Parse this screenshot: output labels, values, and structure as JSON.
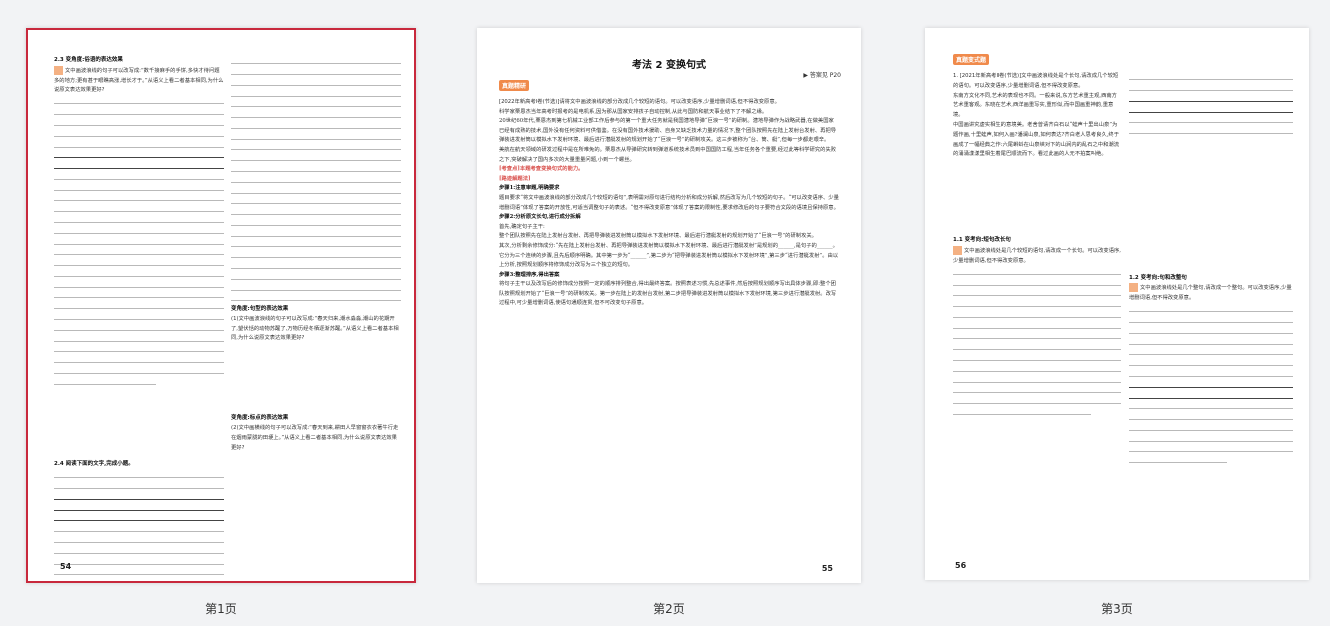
{
  "pages": [
    {
      "label": "第1页",
      "page_number": "54",
      "selected": true,
      "left_col": {
        "sec1_title": "2.3 变角度:俗语的表达效果",
        "sec1_q": "文中画波浪线的句子可以改写成:“数千接麻手的手饼,多快才待问题多的地方;更有甚于眼瞧高涨,增长才于。”从语义上看二者基本相同,为什么说原文表达效果更好?",
        "sec2_title": "2.4 阅读下面的文字,完成小题。"
      },
      "right_col": {
        "sec1_title": "变角度:句型的表达效果",
        "sec1_q": "(1)文中画波浪线的句子可以改写成:“春天归来,潮水淼淼,潮山的花期开了,望伏恬的动物苏醒了,万物历经冬栖逐渐苏醒。”从语义上看二者基本相同,为什么说原文表达效果更好?",
        "sec2_title": "变角度:标点的表达效果",
        "sec2_q": "(2)文中画横线的句子可以改写成:“春天到来,耕田人早窗窗衣衣著牛行走在烟雨蒙胧的田埂上。”从语义上看二者基本相同,为什么说原文表达效果更好?"
      }
    },
    {
      "label": "第2页",
      "page_number": "55",
      "selected": false,
      "title": "考法 2  变换句式",
      "badge1": "真题精研",
      "see_ref": "▶ 答案见 P20",
      "intro": "[2022年新高考Ⅰ卷(节选)]请将文中画波浪线的部分改成几个较短的语句。可以改变语序,少量增删词语,但不得改变原意。",
      "para1": "科学家栗恩杰当年高考时报考的是电机系,因为那从国家安排孩子自动控制,从此与国防和航天事业结下了不解之缘。",
      "para2": "20世纪60年代,栗恩杰到第七机械工业部工作后参与的第一个重大任务就是我国潜地导弹“巨浪一号”的研制。潜地导弹作为战略武器,在做美国家已经有成熟的技术,国外没有任何资料可供借鉴。在没有国外技术援助、自身又缺乏技术力量的情况下,整个团队按照先在陆上发射台发射、再把导弹装进发射筒以模拟水下发射环境、最后进行潜艇发射的规划开始了“巨浪一号”的研制攻关。这三步被称为“台、筒、艇”,但每一步都走艰辛。",
      "para3": "美航在航天领域的研发过程中是在所难免的。栗恩杰从导弹研究转到弹道系统技术员到中国国防工程,当年任务各个重要,经过此等科学研究的失败之下,突破解决了国内多次的大量重量问题,小到一个螺丝。",
      "exam_point": "[考查点]本题考查变换句式的能力。",
      "method_title": "[路迹解题法]",
      "step1": "步骤1:注意审题,明确要求",
      "step1_text": "题目要求“将文中画波浪线的部分改成几个较短的语句”,表明需对原句进行结构分析和成分拆解,然后改写为几个较短的句子。“可以改变语序、少量增删词语”体现了答案的开放性,可适当调整句子的表述。“但不得改变原意”体现了答案的限制性,要求修改后的句子要符合文段的语境且保持原意。",
      "step2": "步骤2:分析原文长句,进行成分拆解",
      "step2_a": "首先,确定句子主干:",
      "step2_b": "整个团队按照先在陆上发射台发射、再把导弹装进发射筒以模拟水下发射环境、最后进行潜艇发射的规划开始了“巨浪一号”的研制攻关。",
      "step2_c": "其次,分析剩余修饰成分:“先在陆上发射台发射、再把导弹装进发射筒以模拟水下发射环境、最后进行潜艇发射”是规划的______,是句子的______。它分为三个连续的步骤,且先后顺序明确。其中第一步为“______”,第二步为“把导弹装进发射筒以模拟水下发射环境”,第三步“进行潜艇发射”。由以上分析,按照规划顺序将修饰成分改写为三个独立的短句。",
      "step3": "步骤3:整理排序,得出答案",
      "step3_text": "将句子主干以及改写后的修饰成分按照一定的顺序排列整合,得出最终答案。按照表述习惯,先总述事件,然后按照规划顺序写出具体步骤,即:整个团队按照规划开始了“巨浪一号”的研制攻关。第一步在陆上的发射台发射,第二步把导弹装进发射筒以模拟水下发射环境,第三步进行潜艇发射。改写过程中,可少量增删词语,使语句通顺连贯,但不可改变句子原意。"
    },
    {
      "label": "第3页",
      "page_number": "56",
      "selected": false,
      "badge": "真题变式题",
      "q1": "1. [2021年新高考Ⅱ卷(节选)]文中画波浪线处是个长句,请改成几个较短的语句。可以改变语序,少量增删词语,但不得改变原意。",
      "q1_text": "东南方文化不同,艺术的表现也不同。一般来说,东方艺术重主观,西南方艺术重客观。东晓在艺术,西洋画重写实,重形似,而中国画重神韵,重意境。",
      "q1_text2": "中国画讲究虚实相生的意境美。老舍曾请齐白石以“蛙声十里出山泉”为题作画,十里蛙声,如何入画?潘澜山泉,如何表达?齐白老人思考良久,终于画成了一幅经典之作:六尾蝌蚪在山泉峡对下的山涧内的乱石之中和潮流的涌涌漾漾里相生着尾巴顺流而下。看过此画的人无不拍案叫绝。",
      "sec12_title": "1.2 变考向:句和改整句",
      "sec12_q": "文中画波浪线处是几个整句,请改成一个整句。可以改变语序,少量增删词语,但不得改变原意。",
      "sec11_title": "1.1 变考向:短句改长句",
      "sec11_q": "文中画波浪线处是几个较短的语句,请改成一个长句。可以改变语序,少量增删词语,但不得改变原意。"
    }
  ]
}
